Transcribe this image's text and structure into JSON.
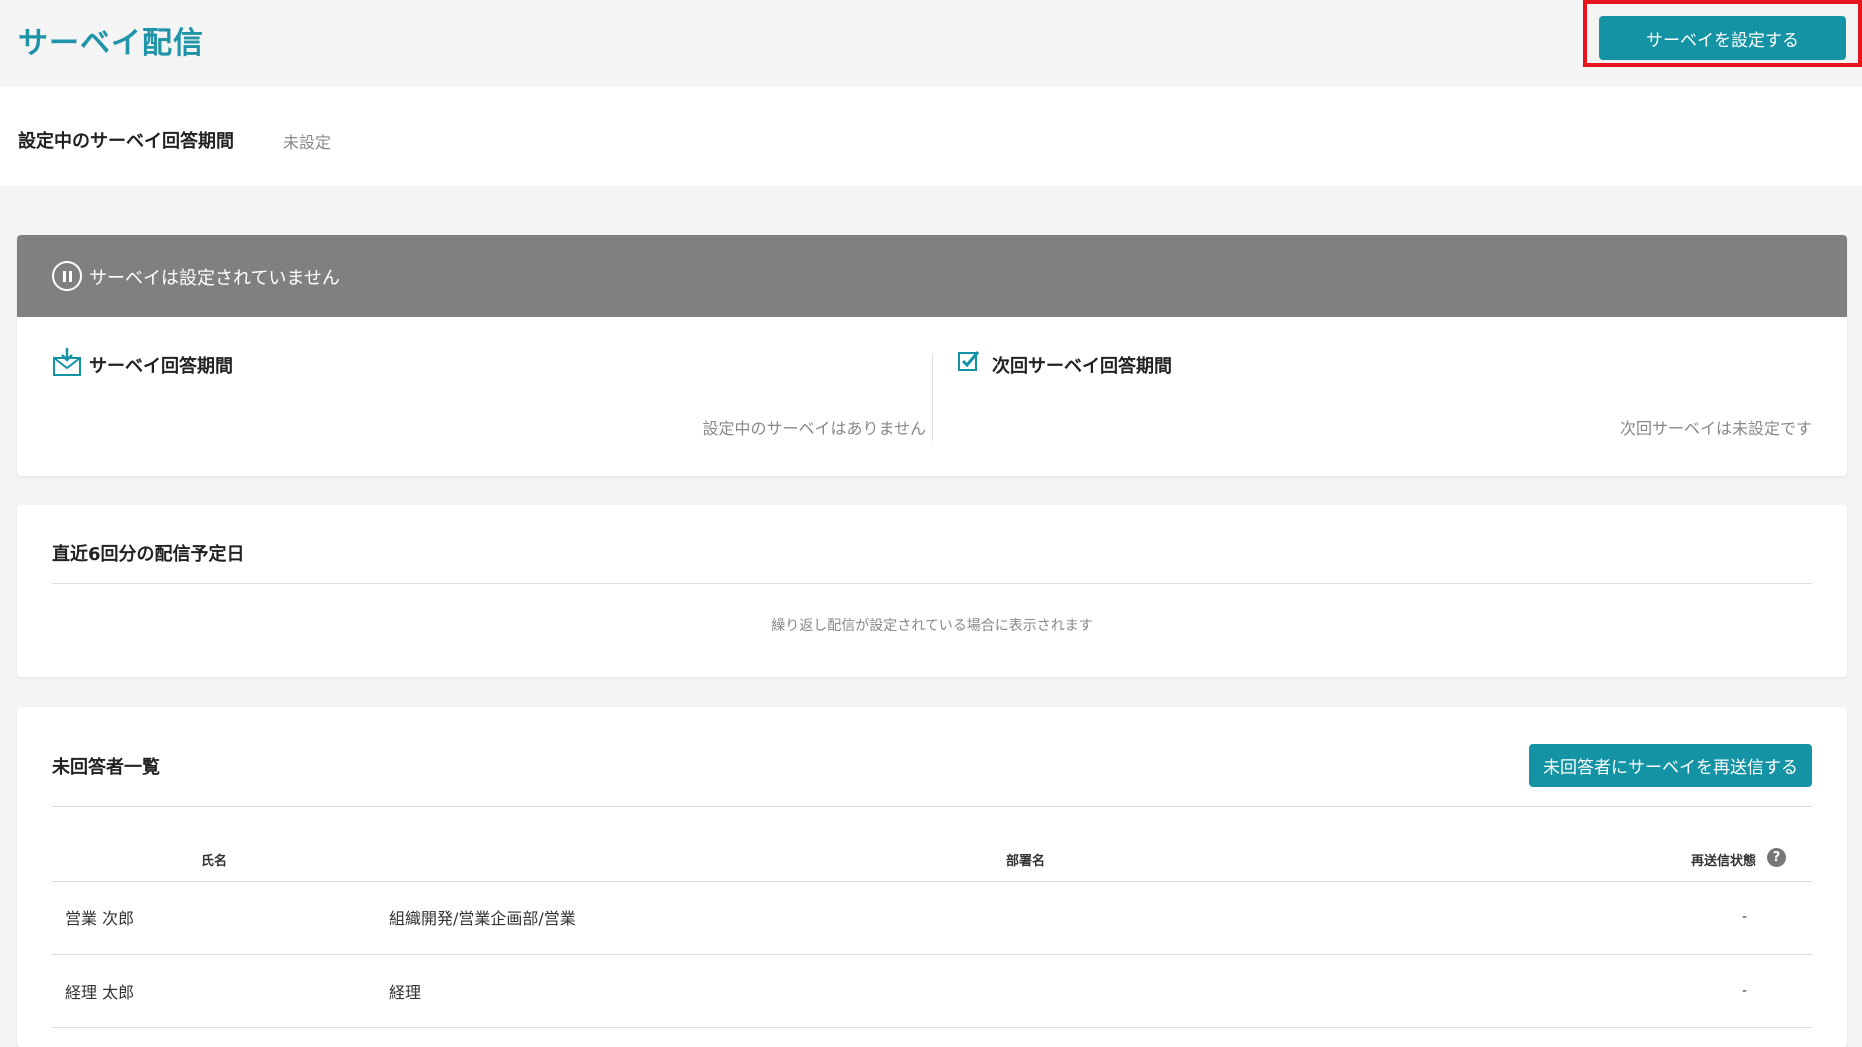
{
  "header": {
    "title": "サーベイ配信",
    "setup_button": "サーベイを設定する"
  },
  "period": {
    "label": "設定中のサーベイ回答期間",
    "value": "未設定"
  },
  "status": {
    "message": "サーベイは設定されていません",
    "current": {
      "title": "サーベイ回答期間",
      "empty": "設定中のサーベイはありません"
    },
    "next": {
      "title": "次回サーベイ回答期間",
      "empty": "次回サーベイは未設定です"
    }
  },
  "schedule": {
    "title": "直近6回分の配信予定日",
    "note": "繰り返し配信が設定されている場合に表示されます"
  },
  "unanswered": {
    "title": "未回答者一覧",
    "resend_button": "未回答者にサーベイを再送信する",
    "columns": [
      "氏名",
      "部署名",
      "再送信状態"
    ],
    "rows": [
      {
        "name": "営業 次郎",
        "department": "組織開発/営業企画部/営業",
        "status": "-"
      },
      {
        "name": "経理 太郎",
        "department": "経理",
        "status": "-"
      }
    ]
  },
  "colors": {
    "accent": "#1493a5",
    "title": "#1f93a8",
    "status_bar": "#808080",
    "highlight": "#e8141b"
  }
}
